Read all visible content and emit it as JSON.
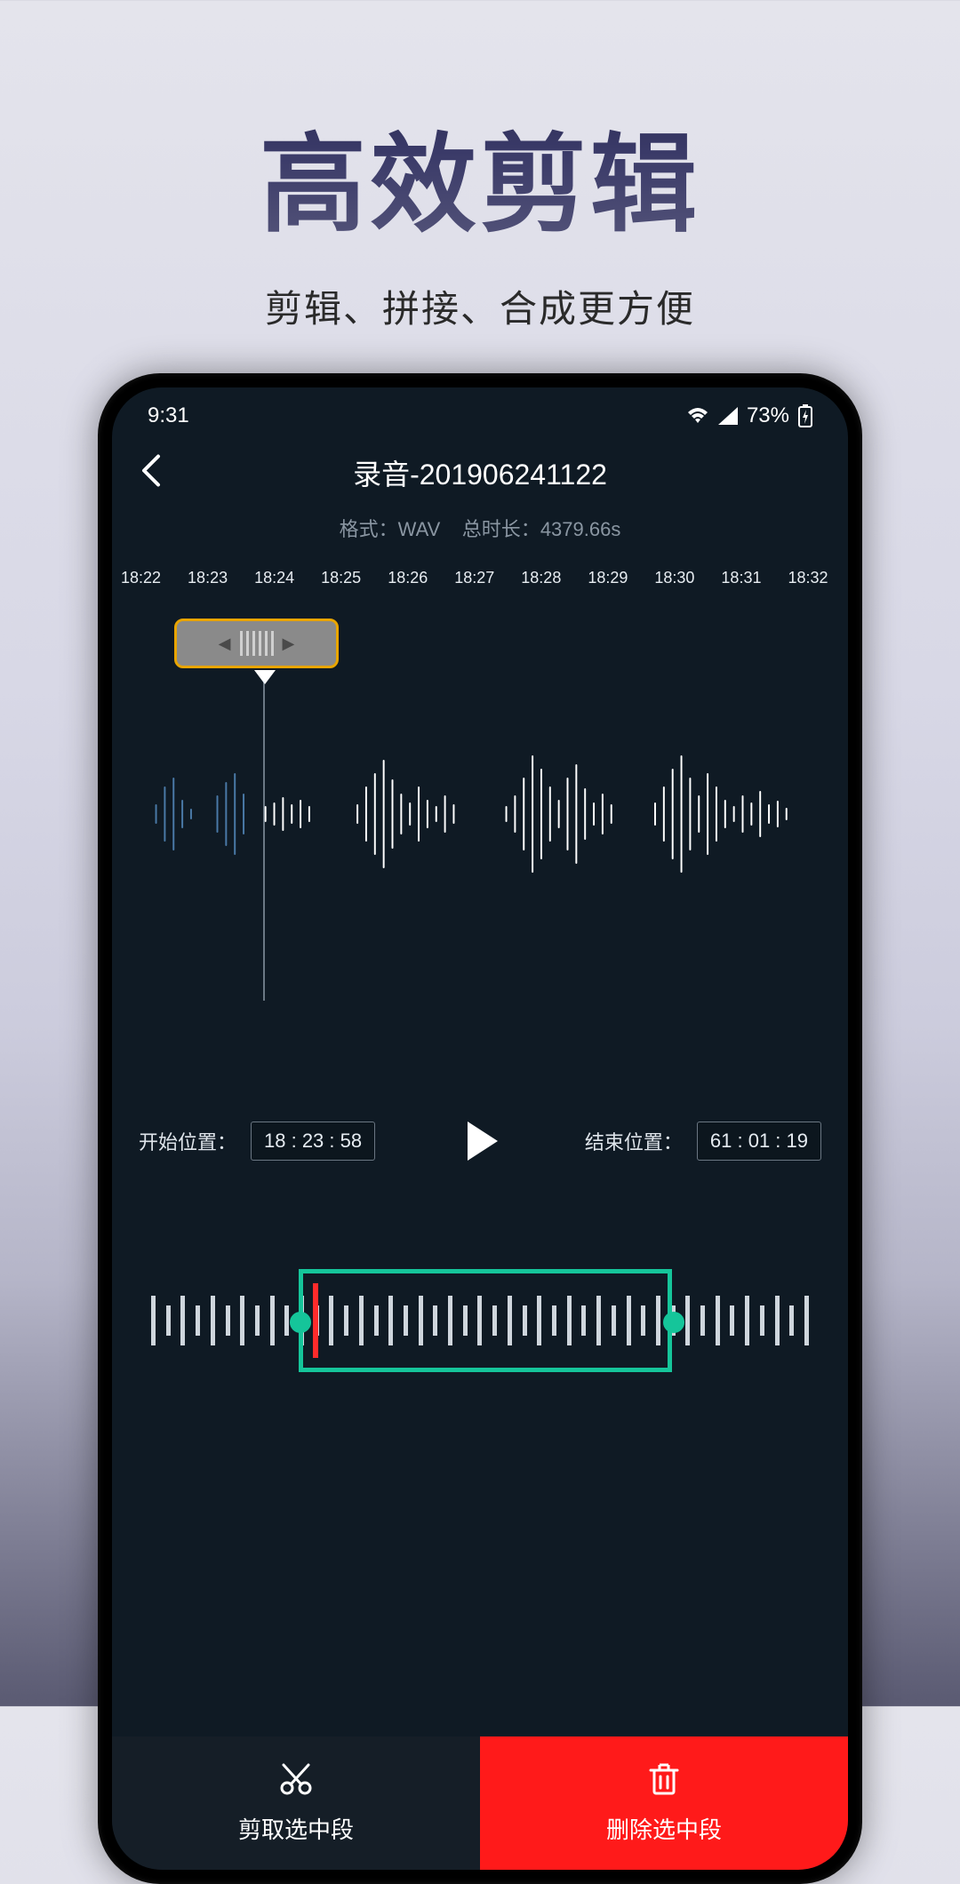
{
  "promo": {
    "title": "高效剪辑",
    "subtitle": "剪辑、拼接、合成更方便"
  },
  "status_bar": {
    "time": "9:31",
    "battery_text": "73%"
  },
  "nav": {
    "title": "录音-201906241122"
  },
  "meta": {
    "format_label": "格式：",
    "format_value": "WAV",
    "duration_label": "总时长：",
    "duration_value": "4379.66s"
  },
  "ruler": {
    "ticks": [
      "18:22",
      "18:23",
      "18:24",
      "18:25",
      "18:26",
      "18:27",
      "18:28",
      "18:29",
      "18:30",
      "18:31",
      "18:32"
    ]
  },
  "controls": {
    "start_label": "开始位置：",
    "start_value": "18 : 23 : 58",
    "end_label": "结束位置：",
    "end_value": "61 : 01 : 19"
  },
  "actions": {
    "cut_label": "剪取选中段",
    "delete_label": "删除选中段"
  }
}
